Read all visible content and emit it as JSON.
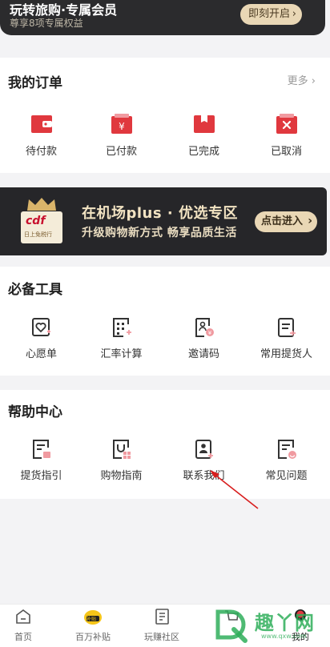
{
  "member": {
    "title": "玩转旅购·专属会员",
    "subtitle": "尊享8项专属权益",
    "button_label": "即刻开启",
    "chevron": "›"
  },
  "orders": {
    "title": "我的订单",
    "more_label": "更多",
    "chevron": "›",
    "items": [
      {
        "label": "待付款",
        "icon": "wallet-icon"
      },
      {
        "label": "已付款",
        "icon": "yen-bag-icon"
      },
      {
        "label": "已完成",
        "icon": "package-icon"
      },
      {
        "label": "已取消",
        "icon": "cancel-bag-icon"
      }
    ]
  },
  "promo": {
    "logo_text": "cdf",
    "logo_sub": "日上免税行",
    "line1": "在机场plus · 优选专区",
    "line2": "升级购物新方式 畅享品质生活",
    "button_label": "点击进入",
    "chevron": "›"
  },
  "tools": {
    "title": "必备工具",
    "items": [
      {
        "label": "心愿单",
        "icon": "wishlist-icon"
      },
      {
        "label": "汇率计算",
        "icon": "calculator-icon"
      },
      {
        "label": "邀请码",
        "icon": "invite-code-icon"
      },
      {
        "label": "常用提货人",
        "icon": "pickup-person-icon"
      }
    ]
  },
  "help": {
    "title": "帮助中心",
    "items": [
      {
        "label": "提货指引",
        "icon": "pickup-guide-icon"
      },
      {
        "label": "购物指南",
        "icon": "shopping-guide-icon"
      },
      {
        "label": "联系我们",
        "icon": "contact-icon"
      },
      {
        "label": "常见问题",
        "icon": "faq-icon"
      }
    ]
  },
  "tabbar": {
    "items": [
      {
        "label": "首页",
        "icon": "home-icon"
      },
      {
        "label": "百万补贴",
        "icon": "subsidy-icon",
        "badge": "补贴"
      },
      {
        "label": "玩赚社区",
        "icon": "community-icon"
      },
      {
        "label": "",
        "icon": "cart-icon"
      },
      {
        "label": "我的",
        "icon": "profile-icon"
      }
    ]
  },
  "watermark": {
    "text": "趣丫网",
    "url": "www.qxw.com"
  },
  "colors": {
    "brand_red": "#e0383e",
    "gold": "#e9d7b5",
    "dark": "#262629",
    "watermark_green": "#2fae5a",
    "arrow_red": "#d81e1e"
  }
}
